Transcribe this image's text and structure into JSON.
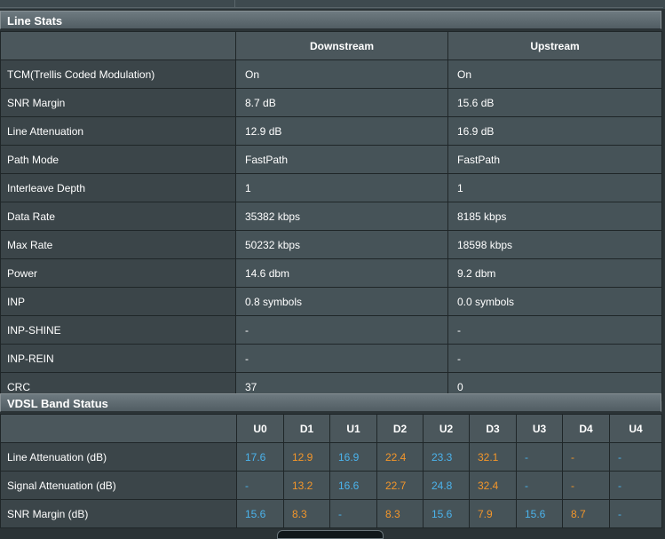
{
  "line_stats": {
    "title": "Line Stats",
    "columns": [
      "Downstream",
      "Upstream"
    ],
    "rows": [
      {
        "label": "TCM(Trellis Coded Modulation)",
        "down": "On",
        "up": "On"
      },
      {
        "label": "SNR Margin",
        "down": "8.7 dB",
        "up": "15.6 dB"
      },
      {
        "label": "Line Attenuation",
        "down": "12.9 dB",
        "up": "16.9 dB"
      },
      {
        "label": "Path Mode",
        "down": "FastPath",
        "up": "FastPath"
      },
      {
        "label": "Interleave Depth",
        "down": "1",
        "up": "1"
      },
      {
        "label": "Data Rate",
        "down": "35382 kbps",
        "up": "8185 kbps"
      },
      {
        "label": "Max Rate",
        "down": "50232 kbps",
        "up": "18598 kbps"
      },
      {
        "label": "Power",
        "down": "14.6 dbm",
        "up": "9.2 dbm"
      },
      {
        "label": "INP",
        "down": "0.8 symbols",
        "up": "0.0 symbols"
      },
      {
        "label": "INP-SHINE",
        "down": "-",
        "up": "-"
      },
      {
        "label": "INP-REIN",
        "down": "-",
        "up": "-"
      },
      {
        "label": "CRC",
        "down": "37",
        "up": "0"
      }
    ]
  },
  "vdsl_band_status": {
    "title": "VDSL Band Status",
    "bands": [
      "U0",
      "D1",
      "U1",
      "D2",
      "U2",
      "D3",
      "U3",
      "D4",
      "U4"
    ],
    "rows": [
      {
        "label": "Line Attenuation (dB)",
        "values": [
          "17.6",
          "12.9",
          "16.9",
          "22.4",
          "23.3",
          "32.1",
          "-",
          "-",
          "-"
        ]
      },
      {
        "label": "Signal Attenuation (dB)",
        "values": [
          "-",
          "13.2",
          "16.6",
          "22.7",
          "24.8",
          "32.4",
          "-",
          "-",
          "-"
        ]
      },
      {
        "label": "SNR Margin (dB)",
        "values": [
          "15.6",
          "8.3",
          "-",
          "8.3",
          "15.6",
          "7.9",
          "15.6",
          "8.7",
          "-"
        ]
      }
    ],
    "colors": {
      "upstream": "#4bb3ec",
      "downstream": "#f3962a"
    }
  }
}
